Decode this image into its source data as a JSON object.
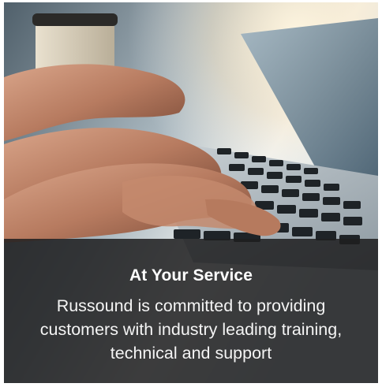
{
  "promo_card": {
    "image_icon": "laptop-typing-photo",
    "title": "At Your Service",
    "description": "Russound is committed to providing customers with industry leading training, technical and support"
  },
  "colors": {
    "overlay": "#1e1e20",
    "text": "#ffffff"
  }
}
